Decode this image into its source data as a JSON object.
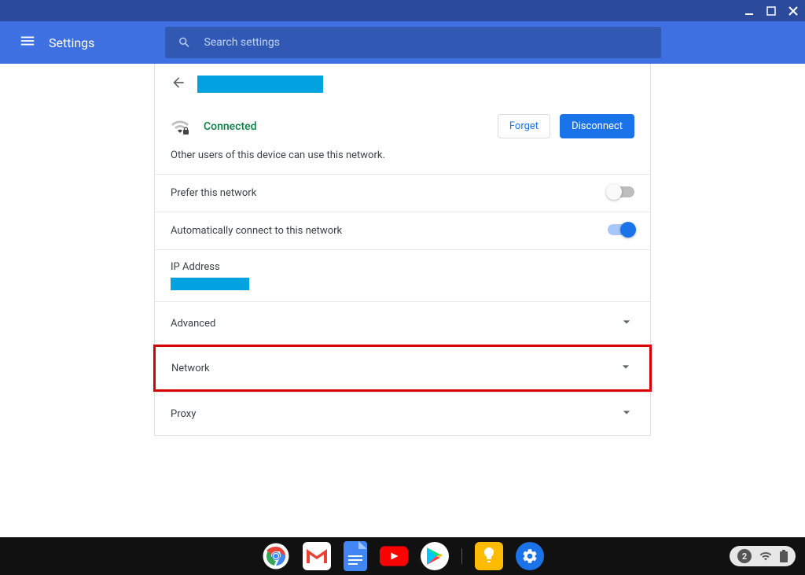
{
  "app_title": "Settings",
  "search_placeholder": "Search settings",
  "network": {
    "status": "Connected",
    "shared_text": "Other users of this device can use this network.",
    "forget_label": "Forget",
    "disconnect_label": "Disconnect"
  },
  "rows": {
    "prefer": "Prefer this network",
    "auto_connect": "Automatically connect to this network",
    "ip_label": "IP Address",
    "advanced": "Advanced",
    "network": "Network",
    "proxy": "Proxy"
  },
  "toggles": {
    "prefer": false,
    "auto_connect": true
  },
  "shelf": {
    "notification_count": "2"
  }
}
